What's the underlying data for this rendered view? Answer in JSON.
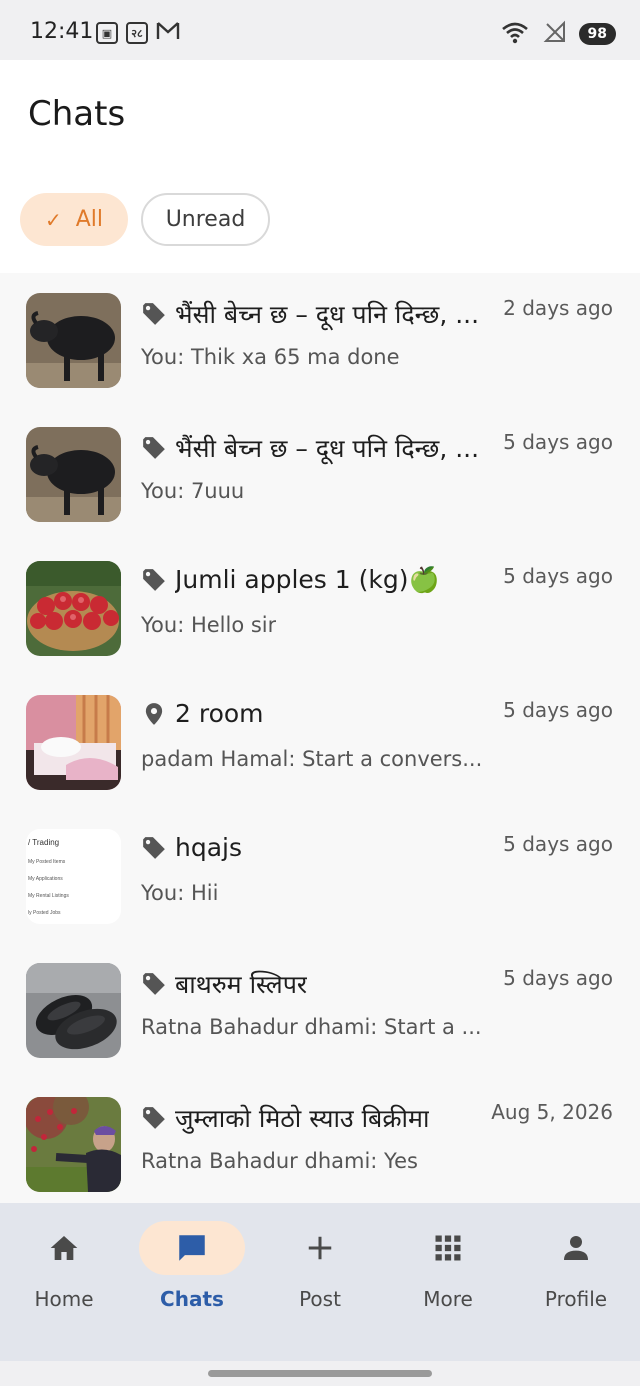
{
  "status_bar": {
    "time": "12:41",
    "battery": "98",
    "icon_names": [
      "screenshot-icon",
      "sim-icon",
      "gmail-icon",
      "wifi-icon",
      "signal-icon"
    ]
  },
  "header": {
    "title": "Chats",
    "filters": {
      "all_label": "All",
      "unread_label": "Unread",
      "active": "All"
    }
  },
  "chats": [
    {
      "icon": "tag-icon",
      "title": "भैंसी बेच्न छ – दूध पनि दिन्छ, ...",
      "time": "2 days ago",
      "preview": "You: Thik xa 65 ma done",
      "thumb": "buffalo"
    },
    {
      "icon": "tag-icon",
      "title": "भैंसी बेच्न छ – दूध पनि दिन्छ, ...",
      "time": "5 days ago",
      "preview": "You: 7uuu",
      "thumb": "buffalo"
    },
    {
      "icon": "tag-icon",
      "title": "Jumli apples 1 (kg)🍏",
      "time": "5 days ago",
      "preview": "You: Hello sir",
      "thumb": "apples"
    },
    {
      "icon": "location-pin-icon",
      "title": "2 room",
      "time": "5 days ago",
      "preview": "padam Hamal: Start a convers...",
      "thumb": "room"
    },
    {
      "icon": "tag-icon",
      "title": "hqajs",
      "time": "5 days ago",
      "preview": "You: Hii",
      "thumb": "screenshot",
      "thumb_text": [
        "/ Trading",
        "My Posted Items",
        "My Applications",
        "My Rental Listings",
        "ly Posted Jobs"
      ]
    },
    {
      "icon": "tag-icon",
      "title": "बाथरुम स्लिपर",
      "time": "5 days ago",
      "preview": "Ratna Bahadur dhami: Start a ...",
      "thumb": "slippers"
    },
    {
      "icon": "tag-icon",
      "title": "जुम्लाको मिठो स्याउ बिक्रीमा",
      "time": "Aug 5, 2026",
      "preview": "Ratna Bahadur dhami: Yes",
      "thumb": "orchard"
    }
  ],
  "bottom_nav": {
    "items": [
      {
        "label": "Home",
        "icon": "home-icon"
      },
      {
        "label": "Chats",
        "icon": "chat-icon"
      },
      {
        "label": "Post",
        "icon": "plus-icon"
      },
      {
        "label": "More",
        "icon": "grid-icon"
      },
      {
        "label": "Profile",
        "icon": "person-icon"
      }
    ],
    "active": "Chats"
  },
  "colors": {
    "accent": "#e07a2a",
    "accent_bg": "#fde6d2",
    "active_nav_text": "#2d5da8",
    "nav_bg": "#e2e5ec"
  }
}
